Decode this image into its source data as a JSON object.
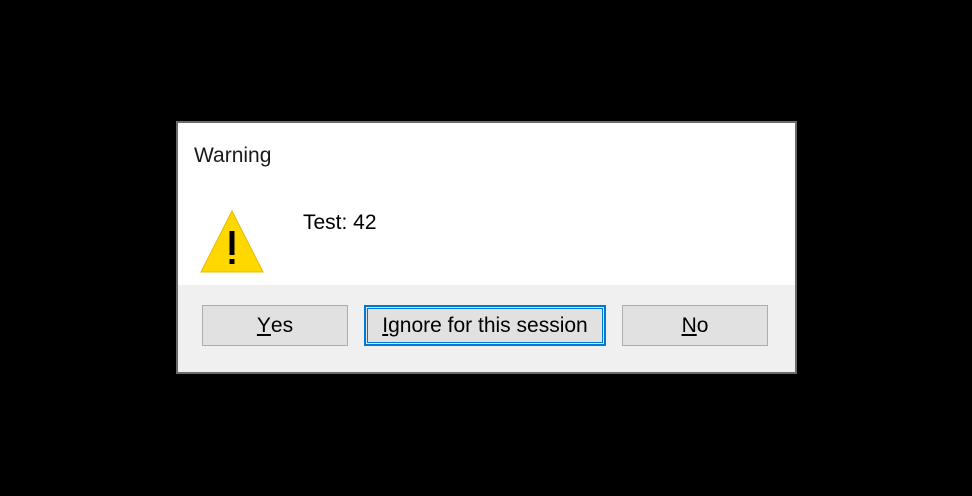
{
  "dialog": {
    "title": "Warning",
    "icon": "warning-triangle-icon",
    "message": "Test: 42",
    "buttons": {
      "yes": {
        "mnemonic": "Y",
        "rest": "es"
      },
      "ignore": {
        "mnemonic": "I",
        "rest": "gnore for this session"
      },
      "no": {
        "mnemonic": "N",
        "rest": "o"
      }
    }
  },
  "colors": {
    "background": "#000000",
    "dialog_content": "#ffffff",
    "dialog_footer": "#f0f0f0",
    "focus_accent": "#0078d7",
    "warning_fill": "#ffd800"
  }
}
